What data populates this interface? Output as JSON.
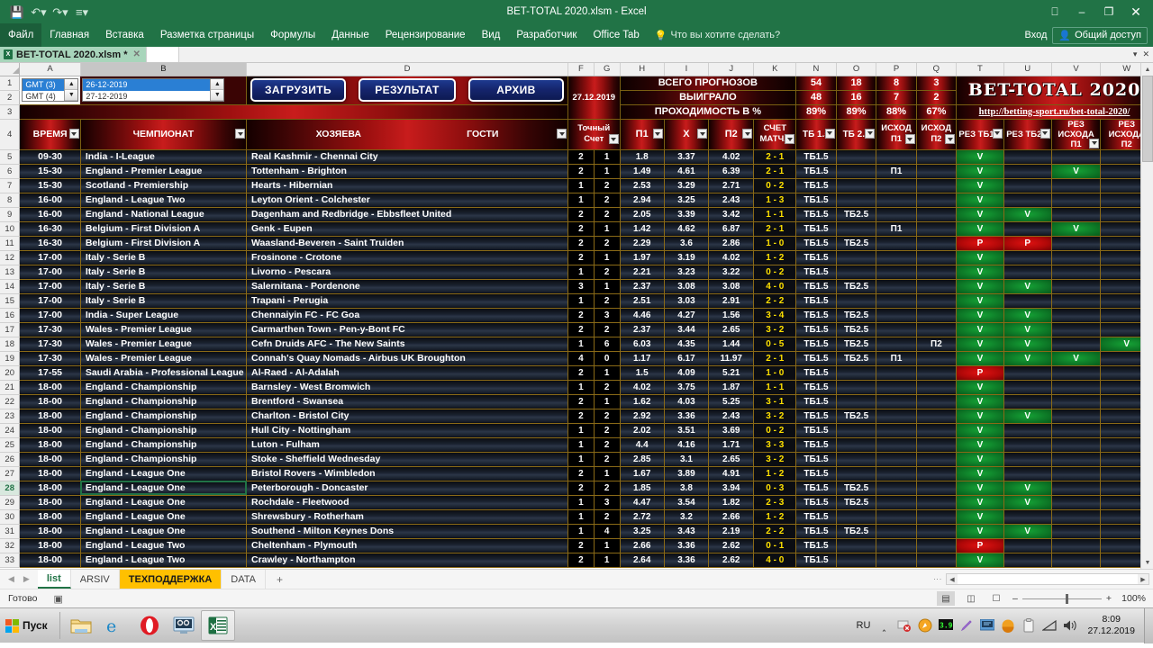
{
  "window": {
    "title": "BET-TOTAL 2020.xlsm - Excel",
    "quick_access": [
      "save-icon",
      "undo-icon",
      "redo-icon",
      "customize-icon"
    ],
    "ribbon_display_icon": "ribbon-display-options-icon",
    "minimize": "–",
    "restore": "❐",
    "close": "✕"
  },
  "ribbon": {
    "tabs": [
      "Файл",
      "Главная",
      "Вставка",
      "Разметка страницы",
      "Формулы",
      "Данные",
      "Рецензирование",
      "Вид",
      "Разработчик",
      "Office Tab"
    ],
    "tellme": "Что вы хотите сделать?",
    "signin": "Вход",
    "share": "Общий доступ"
  },
  "doc_tab": {
    "label": "BET-TOTAL 2020.xlsm *"
  },
  "columns": [
    "A",
    "B",
    "D",
    "F",
    "G",
    "H",
    "I",
    "J",
    "K",
    "N",
    "O",
    "P",
    "Q",
    "T",
    "U",
    "V",
    "W"
  ],
  "selected_column": "B",
  "selected_row": "28",
  "controls": {
    "gmt": {
      "options": [
        "GMT  (3)",
        "GMT  (4)"
      ],
      "selected": "GMT  (3)"
    },
    "date": {
      "options": [
        "26-12-2019",
        "27-12-2019"
      ],
      "selected": "26-12-2019"
    },
    "buttons": [
      "ЗАГРУЗИТЬ",
      "РЕЗУЛЬТАТ",
      "АРХИВ"
    ],
    "current_date": "27.12.2019"
  },
  "stats": {
    "rows": [
      {
        "label": "ВСЕГО ПРОГНОЗОВ",
        "values": [
          "54",
          "18",
          "8",
          "3"
        ]
      },
      {
        "label": "ВЫИГРАЛО",
        "values": [
          "48",
          "16",
          "7",
          "2"
        ]
      },
      {
        "label": "ПРОХОДИМОСТЬ В %",
        "values": [
          "89%",
          "89%",
          "88%",
          "67%"
        ]
      }
    ]
  },
  "logo": {
    "title": "BET-TOTAL 2020",
    "url": "http://betting-sport.ru/bet-total-2020/"
  },
  "headers": {
    "time": "ВРЕМЯ",
    "championship": "ЧЕМПИОНАТ",
    "home": "ХОЗЯЕВА",
    "away": "ГОСТИ",
    "exact_score": [
      "Точный",
      "Счет"
    ],
    "p1": "П1",
    "x": "X",
    "p2": "П2",
    "match_score": [
      "СЧЕТ",
      "МАТЧА"
    ],
    "tb15": "ТБ 1.5",
    "tb25": "ТБ 2.5",
    "outcome_p1": [
      "ИСХОД",
      "П1"
    ],
    "outcome_p2": [
      "ИСХОД",
      "П2"
    ],
    "res_tb15": "РЕЗ ТБ1.5",
    "res_tb25": "РЕЗ ТБ2.5",
    "res_outcome_p1": [
      "РЕЗ",
      "ИСХОДА",
      "П1"
    ],
    "res_outcome_p2": [
      "РЕЗ",
      "ИСХОДА",
      "П2"
    ]
  },
  "rows": [
    {
      "n": "5",
      "time": "09-30",
      "league": "India - I-League",
      "match": "Real Kashmir - Chennai City",
      "f": "2",
      "g": "1",
      "p1": "1.8",
      "x": "3.37",
      "p2": "4.02",
      "score": "2 - 1",
      "tb15": "ТБ1.5",
      "tb25": "",
      "op1": "",
      "op2": "",
      "rtb15": "V",
      "rtb25": "",
      "rop1": "",
      "rop2": ""
    },
    {
      "n": "6",
      "time": "15-30",
      "league": "England - Premier League",
      "match": "Tottenham - Brighton",
      "f": "2",
      "g": "1",
      "p1": "1.49",
      "x": "4.61",
      "p2": "6.39",
      "score": "2 - 1",
      "tb15": "ТБ1.5",
      "tb25": "",
      "op1": "П1",
      "op2": "",
      "rtb15": "V",
      "rtb25": "",
      "rop1": "V",
      "rop2": ""
    },
    {
      "n": "7",
      "time": "15-30",
      "league": "Scotland - Premiership",
      "match": "Hearts - Hibernian",
      "f": "1",
      "g": "2",
      "p1": "2.53",
      "x": "3.29",
      "p2": "2.71",
      "score": "0 - 2",
      "tb15": "ТБ1.5",
      "tb25": "",
      "op1": "",
      "op2": "",
      "rtb15": "V",
      "rtb25": "",
      "rop1": "",
      "rop2": ""
    },
    {
      "n": "8",
      "time": "16-00",
      "league": "England - League Two",
      "match": "Leyton Orient - Colchester",
      "f": "1",
      "g": "2",
      "p1": "2.94",
      "x": "3.25",
      "p2": "2.43",
      "score": "1 - 3",
      "tb15": "ТБ1.5",
      "tb25": "",
      "op1": "",
      "op2": "",
      "rtb15": "V",
      "rtb25": "",
      "rop1": "",
      "rop2": ""
    },
    {
      "n": "9",
      "time": "16-00",
      "league": "England - National League",
      "match": "Dagenham and Redbridge - Ebbsfleet United",
      "f": "2",
      "g": "2",
      "p1": "2.05",
      "x": "3.39",
      "p2": "3.42",
      "score": "1 - 1",
      "tb15": "ТБ1.5",
      "tb25": "ТБ2.5",
      "op1": "",
      "op2": "",
      "rtb15": "V",
      "rtb25": "V",
      "rop1": "",
      "rop2": ""
    },
    {
      "n": "10",
      "time": "16-30",
      "league": "Belgium - First Division A",
      "match": "Genk - Eupen",
      "f": "2",
      "g": "1",
      "p1": "1.42",
      "x": "4.62",
      "p2": "6.87",
      "score": "2 - 1",
      "tb15": "ТБ1.5",
      "tb25": "",
      "op1": "П1",
      "op2": "",
      "rtb15": "V",
      "rtb25": "",
      "rop1": "V",
      "rop2": ""
    },
    {
      "n": "11",
      "time": "16-30",
      "league": "Belgium - First Division A",
      "match": "Waasland-Beveren - Saint Truiden",
      "f": "2",
      "g": "2",
      "p1": "2.29",
      "x": "3.6",
      "p2": "2.86",
      "score": "1 - 0",
      "tb15": "ТБ1.5",
      "tb25": "ТБ2.5",
      "op1": "",
      "op2": "",
      "rtb15": "P",
      "rtb25": "P",
      "rop1": "",
      "rop2": ""
    },
    {
      "n": "12",
      "time": "17-00",
      "league": "Italy - Serie B",
      "match": "Frosinone - Crotone",
      "f": "2",
      "g": "1",
      "p1": "1.97",
      "x": "3.19",
      "p2": "4.02",
      "score": "1 - 2",
      "tb15": "ТБ1.5",
      "tb25": "",
      "op1": "",
      "op2": "",
      "rtb15": "V",
      "rtb25": "",
      "rop1": "",
      "rop2": ""
    },
    {
      "n": "13",
      "time": "17-00",
      "league": "Italy - Serie B",
      "match": "Livorno - Pescara",
      "f": "1",
      "g": "2",
      "p1": "2.21",
      "x": "3.23",
      "p2": "3.22",
      "score": "0 - 2",
      "tb15": "ТБ1.5",
      "tb25": "",
      "op1": "",
      "op2": "",
      "rtb15": "V",
      "rtb25": "",
      "rop1": "",
      "rop2": ""
    },
    {
      "n": "14",
      "time": "17-00",
      "league": "Italy - Serie B",
      "match": "Salernitana - Pordenone",
      "f": "3",
      "g": "1",
      "p1": "2.37",
      "x": "3.08",
      "p2": "3.08",
      "score": "4 - 0",
      "tb15": "ТБ1.5",
      "tb25": "ТБ2.5",
      "op1": "",
      "op2": "",
      "rtb15": "V",
      "rtb25": "V",
      "rop1": "",
      "rop2": ""
    },
    {
      "n": "15",
      "time": "17-00",
      "league": "Italy - Serie B",
      "match": "Trapani - Perugia",
      "f": "1",
      "g": "2",
      "p1": "2.51",
      "x": "3.03",
      "p2": "2.91",
      "score": "2 - 2",
      "tb15": "ТБ1.5",
      "tb25": "",
      "op1": "",
      "op2": "",
      "rtb15": "V",
      "rtb25": "",
      "rop1": "",
      "rop2": ""
    },
    {
      "n": "16",
      "time": "17-00",
      "league": "India - Super League",
      "match": "Chennaiyin FC - FC Goa",
      "f": "2",
      "g": "3",
      "p1": "4.46",
      "x": "4.27",
      "p2": "1.56",
      "score": "3 - 4",
      "tb15": "ТБ1.5",
      "tb25": "ТБ2.5",
      "op1": "",
      "op2": "",
      "rtb15": "V",
      "rtb25": "V",
      "rop1": "",
      "rop2": ""
    },
    {
      "n": "17",
      "time": "17-30",
      "league": "Wales - Premier League",
      "match": "Carmarthen Town - Pen-y-Bont FC",
      "f": "2",
      "g": "2",
      "p1": "2.37",
      "x": "3.44",
      "p2": "2.65",
      "score": "3 - 2",
      "tb15": "ТБ1.5",
      "tb25": "ТБ2.5",
      "op1": "",
      "op2": "",
      "rtb15": "V",
      "rtb25": "V",
      "rop1": "",
      "rop2": ""
    },
    {
      "n": "18",
      "time": "17-30",
      "league": "Wales - Premier League",
      "match": "Cefn Druids AFC - The New Saints",
      "f": "1",
      "g": "6",
      "p1": "6.03",
      "x": "4.35",
      "p2": "1.44",
      "score": "0 - 5",
      "tb15": "ТБ1.5",
      "tb25": "ТБ2.5",
      "op1": "",
      "op2": "П2",
      "rtb15": "V",
      "rtb25": "V",
      "rop1": "",
      "rop2": "V"
    },
    {
      "n": "19",
      "time": "17-30",
      "league": "Wales - Premier League",
      "match": "Connah's Quay Nomads - Airbus UK Broughton",
      "f": "4",
      "g": "0",
      "p1": "1.17",
      "x": "6.17",
      "p2": "11.97",
      "score": "2 - 1",
      "tb15": "ТБ1.5",
      "tb25": "ТБ2.5",
      "op1": "П1",
      "op2": "",
      "rtb15": "V",
      "rtb25": "V",
      "rop1": "V",
      "rop2": ""
    },
    {
      "n": "20",
      "time": "17-55",
      "league": "Saudi Arabia - Professional League",
      "match": "Al-Raed - Al-Adalah",
      "f": "2",
      "g": "1",
      "p1": "1.5",
      "x": "4.09",
      "p2": "5.21",
      "score": "1 - 0",
      "tb15": "ТБ1.5",
      "tb25": "",
      "op1": "",
      "op2": "",
      "rtb15": "P",
      "rtb25": "",
      "rop1": "",
      "rop2": ""
    },
    {
      "n": "21",
      "time": "18-00",
      "league": "England - Championship",
      "match": "Barnsley - West Bromwich",
      "f": "1",
      "g": "2",
      "p1": "4.02",
      "x": "3.75",
      "p2": "1.87",
      "score": "1 - 1",
      "tb15": "ТБ1.5",
      "tb25": "",
      "op1": "",
      "op2": "",
      "rtb15": "V",
      "rtb25": "",
      "rop1": "",
      "rop2": ""
    },
    {
      "n": "22",
      "time": "18-00",
      "league": "England - Championship",
      "match": "Brentford - Swansea",
      "f": "2",
      "g": "1",
      "p1": "1.62",
      "x": "4.03",
      "p2": "5.25",
      "score": "3 - 1",
      "tb15": "ТБ1.5",
      "tb25": "",
      "op1": "",
      "op2": "",
      "rtb15": "V",
      "rtb25": "",
      "rop1": "",
      "rop2": ""
    },
    {
      "n": "23",
      "time": "18-00",
      "league": "England - Championship",
      "match": "Charlton - Bristol City",
      "f": "2",
      "g": "2",
      "p1": "2.92",
      "x": "3.36",
      "p2": "2.43",
      "score": "3 - 2",
      "tb15": "ТБ1.5",
      "tb25": "ТБ2.5",
      "op1": "",
      "op2": "",
      "rtb15": "V",
      "rtb25": "V",
      "rop1": "",
      "rop2": ""
    },
    {
      "n": "24",
      "time": "18-00",
      "league": "England - Championship",
      "match": "Hull City - Nottingham",
      "f": "1",
      "g": "2",
      "p1": "2.02",
      "x": "3.51",
      "p2": "3.69",
      "score": "0 - 2",
      "tb15": "ТБ1.5",
      "tb25": "",
      "op1": "",
      "op2": "",
      "rtb15": "V",
      "rtb25": "",
      "rop1": "",
      "rop2": ""
    },
    {
      "n": "25",
      "time": "18-00",
      "league": "England - Championship",
      "match": "Luton - Fulham",
      "f": "1",
      "g": "2",
      "p1": "4.4",
      "x": "4.16",
      "p2": "1.71",
      "score": "3 - 3",
      "tb15": "ТБ1.5",
      "tb25": "",
      "op1": "",
      "op2": "",
      "rtb15": "V",
      "rtb25": "",
      "rop1": "",
      "rop2": ""
    },
    {
      "n": "26",
      "time": "18-00",
      "league": "England - Championship",
      "match": "Stoke - Sheffield Wednesday",
      "f": "1",
      "g": "2",
      "p1": "2.85",
      "x": "3.1",
      "p2": "2.65",
      "score": "3 - 2",
      "tb15": "ТБ1.5",
      "tb25": "",
      "op1": "",
      "op2": "",
      "rtb15": "V",
      "rtb25": "",
      "rop1": "",
      "rop2": ""
    },
    {
      "n": "27",
      "time": "18-00",
      "league": "England - League One",
      "match": "Bristol Rovers - Wimbledon",
      "f": "2",
      "g": "1",
      "p1": "1.67",
      "x": "3.89",
      "p2": "4.91",
      "score": "1 - 2",
      "tb15": "ТБ1.5",
      "tb25": "",
      "op1": "",
      "op2": "",
      "rtb15": "V",
      "rtb25": "",
      "rop1": "",
      "rop2": ""
    },
    {
      "n": "28",
      "time": "18-00",
      "league": "England - League One",
      "match": "Peterborough - Doncaster",
      "f": "2",
      "g": "2",
      "p1": "1.85",
      "x": "3.8",
      "p2": "3.94",
      "score": "0 - 3",
      "tb15": "ТБ1.5",
      "tb25": "ТБ2.5",
      "op1": "",
      "op2": "",
      "rtb15": "V",
      "rtb25": "V",
      "rop1": "",
      "rop2": ""
    },
    {
      "n": "29",
      "time": "18-00",
      "league": "England - League One",
      "match": "Rochdale - Fleetwood",
      "f": "1",
      "g": "3",
      "p1": "4.47",
      "x": "3.54",
      "p2": "1.82",
      "score": "2 - 3",
      "tb15": "ТБ1.5",
      "tb25": "ТБ2.5",
      "op1": "",
      "op2": "",
      "rtb15": "V",
      "rtb25": "V",
      "rop1": "",
      "rop2": ""
    },
    {
      "n": "30",
      "time": "18-00",
      "league": "England - League One",
      "match": "Shrewsbury - Rotherham",
      "f": "1",
      "g": "2",
      "p1": "2.72",
      "x": "3.2",
      "p2": "2.66",
      "score": "1 - 2",
      "tb15": "ТБ1.5",
      "tb25": "",
      "op1": "",
      "op2": "",
      "rtb15": "V",
      "rtb25": "",
      "rop1": "",
      "rop2": ""
    },
    {
      "n": "31",
      "time": "18-00",
      "league": "England - League One",
      "match": "Southend - Milton Keynes Dons",
      "f": "1",
      "g": "4",
      "p1": "3.25",
      "x": "3.43",
      "p2": "2.19",
      "score": "2 - 2",
      "tb15": "ТБ1.5",
      "tb25": "ТБ2.5",
      "op1": "",
      "op2": "",
      "rtb15": "V",
      "rtb25": "V",
      "rop1": "",
      "rop2": ""
    },
    {
      "n": "32",
      "time": "18-00",
      "league": "England - League Two",
      "match": "Cheltenham - Plymouth",
      "f": "2",
      "g": "1",
      "p1": "2.66",
      "x": "3.36",
      "p2": "2.62",
      "score": "0 - 1",
      "tb15": "ТБ1.5",
      "tb25": "",
      "op1": "",
      "op2": "",
      "rtb15": "P",
      "rtb25": "",
      "rop1": "",
      "rop2": ""
    },
    {
      "n": "33",
      "time": "18-00",
      "league": "England - League Two",
      "match": "Crawley - Northampton",
      "f": "2",
      "g": "1",
      "p1": "2.64",
      "x": "3.36",
      "p2": "2.62",
      "score": "4 - 0",
      "tb15": "ТБ1.5",
      "tb25": "",
      "op1": "",
      "op2": "",
      "rtb15": "V",
      "rtb25": "",
      "rop1": "",
      "rop2": ""
    }
  ],
  "sheet_tabs": [
    {
      "label": "list",
      "state": "active"
    },
    {
      "label": "ARSIV",
      "state": "normal"
    },
    {
      "label": "ТЕХПОДДЕРЖКА",
      "state": "highlighted"
    },
    {
      "label": "DATA",
      "state": "normal"
    }
  ],
  "add_sheet": "+",
  "statusbar": {
    "ready": "Готово",
    "record_macro_icon": "record-macro-icon",
    "views": [
      "normal-view-icon",
      "page-layout-icon",
      "page-break-icon"
    ],
    "zoom_out": "–",
    "zoom_in": "+",
    "zoom": "100%"
  },
  "taskbar": {
    "start": "Пуск",
    "apps": [
      "file-explorer-icon",
      "internet-explorer-icon",
      "opera-icon",
      "snipping-tool-icon",
      "excel-icon"
    ],
    "tray": [
      "RU",
      "show-hidden-icon",
      "antivirus-icon",
      "compass-icon",
      "green-monitor-icon",
      "pen-icon",
      "network-app-icon",
      "sun-icon",
      "clipboard-icon",
      "signal-icon",
      "volume-icon"
    ],
    "clock_time": "8:09",
    "clock_date": "27.12.2019"
  }
}
